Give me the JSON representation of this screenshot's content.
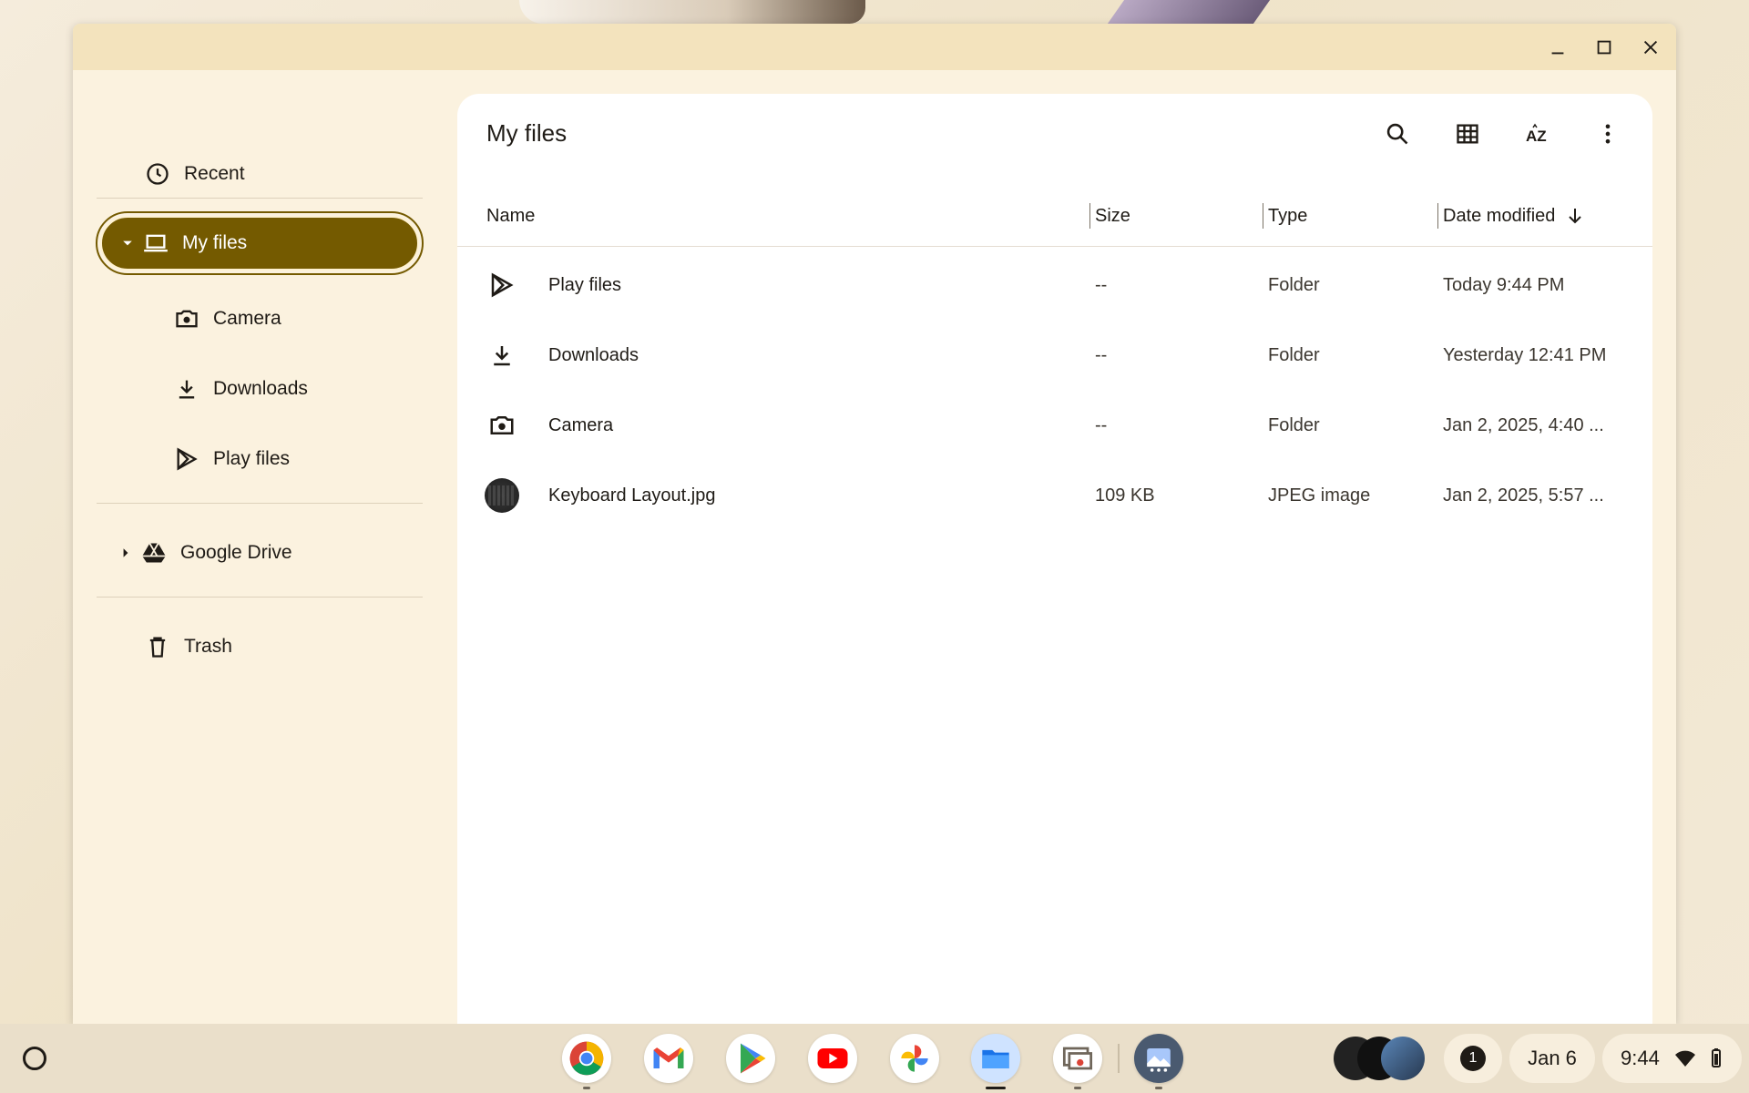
{
  "window": {
    "controls": {
      "minimize": "minimize-icon",
      "maximize": "maximize-icon",
      "close": "close-icon"
    }
  },
  "sidebar": {
    "recent": "Recent",
    "my_files": "My files",
    "camera": "Camera",
    "downloads": "Downloads",
    "play_files": "Play files",
    "google_drive": "Google Drive",
    "trash": "Trash"
  },
  "content": {
    "title": "My files",
    "toolbar": [
      "search-icon",
      "grid-view-icon",
      "sort-az-icon",
      "more-vert-icon"
    ],
    "columns": {
      "name": "Name",
      "size": "Size",
      "type": "Type",
      "date": "Date modified"
    },
    "rows": [
      {
        "icon": "play-files-icon",
        "name": "Play files",
        "size": "--",
        "type": "Folder",
        "date": "Today 9:44 PM"
      },
      {
        "icon": "download-icon",
        "name": "Downloads",
        "size": "--",
        "type": "Folder",
        "date": "Yesterday 12:41 PM"
      },
      {
        "icon": "camera-icon",
        "name": "Camera",
        "size": "--",
        "type": "Folder",
        "date": "Jan 2, 2025, 4:40 ..."
      },
      {
        "icon": "image-thumbnail",
        "name": "Keyboard Layout.jpg",
        "size": "109 KB",
        "type": "JPEG image",
        "date": "Jan 2, 2025, 5:57 ..."
      }
    ]
  },
  "shelf": {
    "apps": [
      "chrome-icon",
      "gmail-icon",
      "play-store-icon",
      "youtube-icon",
      "photos-icon",
      "files-icon",
      "screen-capture-icon",
      "gallery-icon"
    ],
    "notification_count": "1",
    "date": "Jan 6",
    "time": "9:44"
  },
  "colors": {
    "accent": "#745a00",
    "window_bg": "#fbf2df",
    "titlebar": "#f3e3bd"
  }
}
